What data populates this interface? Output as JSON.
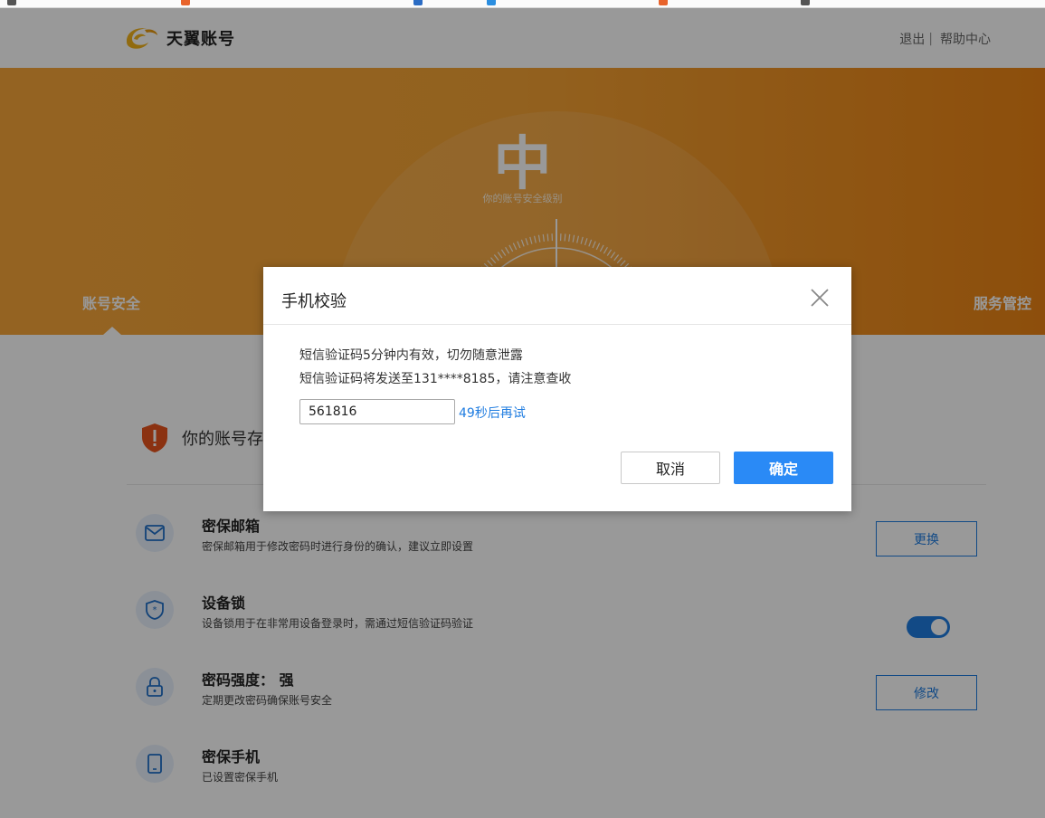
{
  "header": {
    "brand": "天翼账号",
    "logout": "退出",
    "separator": "|",
    "help": "帮助中心"
  },
  "banner": {
    "level": "中",
    "level_caption": "你的账号安全级别",
    "tabs": [
      "账号安全",
      "服务管控"
    ]
  },
  "warning": {
    "text": "你的账号存"
  },
  "security_items": [
    {
      "title": "密保邮箱",
      "desc": "密保邮箱用于修改密码时进行身份的确认，建议立即设置",
      "action": "更换",
      "icon": "mail-icon"
    },
    {
      "title": "设备锁",
      "desc": "设备锁用于在非常用设备登录时，需通过短信验证码验证",
      "toggle": "on",
      "icon": "shield-star-icon"
    },
    {
      "title": "密码强度：  强",
      "desc": "定期更改密码确保账号安全",
      "action": "修改",
      "icon": "lock-icon"
    },
    {
      "title": "密保手机",
      "desc": "已设置密保手机",
      "icon": "phone-icon"
    }
  ],
  "modal": {
    "title": "手机校验",
    "line1": "短信验证码5分钟内有效，切勿随意泄露",
    "line2": "短信验证码将发送至131****8185，请注意查收",
    "code_value": "561816",
    "countdown": "49秒后再试",
    "cancel": "取消",
    "confirm": "确定"
  },
  "colors": {
    "brand_orange": "#f4a234",
    "accent_blue": "#1f7ce0",
    "confirm_blue": "#2a8af6"
  }
}
